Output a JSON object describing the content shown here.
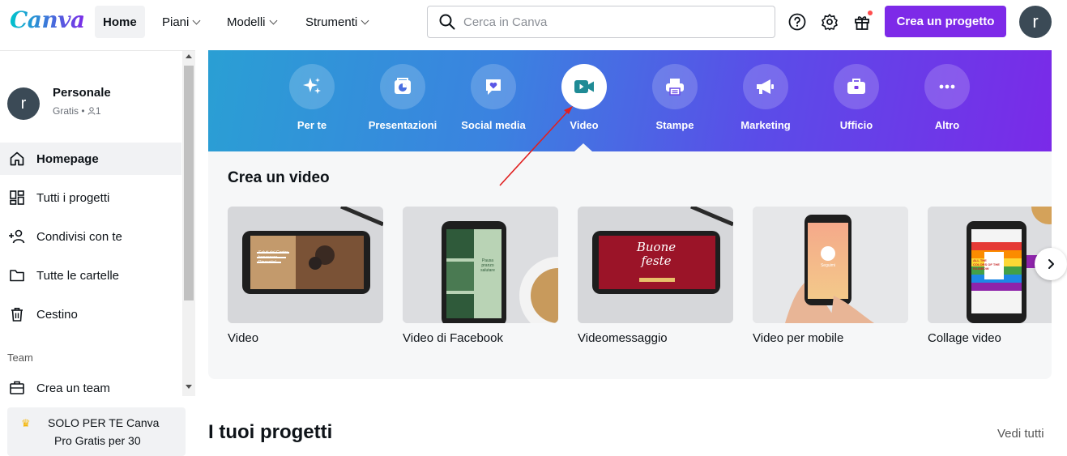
{
  "header": {
    "logo": "Canva",
    "nav": [
      {
        "label": "Home",
        "active": true,
        "dropdown": false
      },
      {
        "label": "Piani",
        "active": false,
        "dropdown": true
      },
      {
        "label": "Modelli",
        "active": false,
        "dropdown": true
      },
      {
        "label": "Strumenti",
        "active": false,
        "dropdown": true
      }
    ],
    "search_placeholder": "Cerca in Canva",
    "icons": [
      "help-icon",
      "settings-icon",
      "gift-icon"
    ],
    "create_button": "Crea un progetto",
    "avatar_initial": "r"
  },
  "sidebar": {
    "profile": {
      "initial": "r",
      "name": "Personale",
      "plan": "Gratis •",
      "members": "1"
    },
    "items": [
      {
        "label": "Homepage",
        "icon": "home-icon",
        "active": true
      },
      {
        "label": "Tutti i progetti",
        "icon": "grid-icon",
        "active": false
      },
      {
        "label": "Condivisi con te",
        "icon": "shared-users-icon",
        "active": false
      },
      {
        "label": "Tutte le cartelle",
        "icon": "folder-icon",
        "active": false
      },
      {
        "label": "Cestino",
        "icon": "trash-icon",
        "active": false
      }
    ],
    "team_section_label": "Team",
    "team_item": {
      "label": "Crea un team",
      "icon": "team-icon"
    },
    "promo": {
      "line1": "SOLO PER TE Canva",
      "line2": "Pro Gratis per 30"
    }
  },
  "categories": [
    {
      "label": "Per te",
      "icon": "sparkle-icon",
      "active": false
    },
    {
      "label": "Presentazioni",
      "icon": "presentation-icon",
      "active": false
    },
    {
      "label": "Social media",
      "icon": "heart-chat-icon",
      "active": false
    },
    {
      "label": "Video",
      "icon": "video-camera-icon",
      "active": true
    },
    {
      "label": "Stampe",
      "icon": "printer-icon",
      "active": false
    },
    {
      "label": "Marketing",
      "icon": "megaphone-icon",
      "active": false
    },
    {
      "label": "Ufficio",
      "icon": "briefcase-icon",
      "active": false
    },
    {
      "label": "Altro",
      "icon": "more-icon",
      "active": false
    }
  ],
  "panel": {
    "title": "Crea un video",
    "cards": [
      {
        "caption": "Video",
        "thumb_text": "Saluti dal Centro benessere Rinascita!"
      },
      {
        "caption": "Video di Facebook",
        "thumb_text": "Pausa pranzo salutare"
      },
      {
        "caption": "Videomessaggio",
        "thumb_text": "Buone feste"
      },
      {
        "caption": "Video per mobile",
        "thumb_text": "Seguimi"
      },
      {
        "caption": "Collage video",
        "thumb_text": "ALL THE COLORS OF THE RAINBOW"
      }
    ]
  },
  "projects": {
    "title": "I tuoi progetti",
    "see_all": "Vedi tutti"
  },
  "colors": {
    "brand_purple": "#7d2ae8",
    "brand_teal": "#00c4cc",
    "annotation_arrow": "#e02020"
  }
}
